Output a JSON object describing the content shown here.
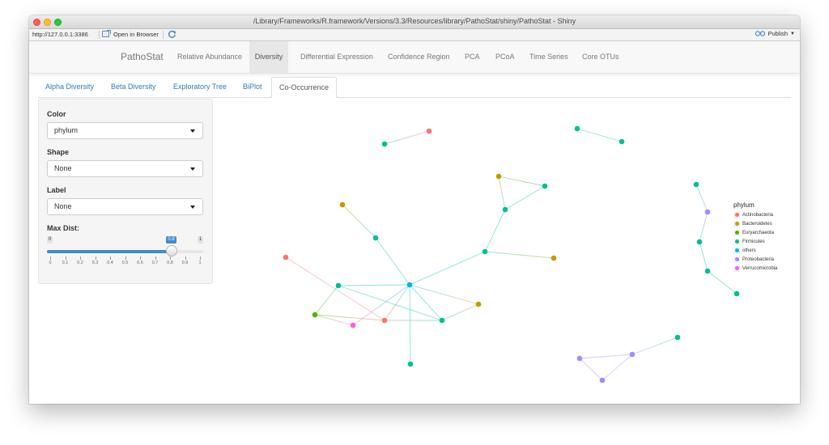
{
  "window": {
    "title": "/Library/Frameworks/R.framework/Versions/3.3/Resources/library/PathoStat/shiny/PathoStat - Shiny"
  },
  "toolbar": {
    "url": "http://127.0.0.1:3386",
    "open_in_browser": "Open in Browser",
    "publish": "Publish"
  },
  "navbar": {
    "brand": "PathoStat",
    "items": [
      {
        "label": "Relative Abundance"
      },
      {
        "label": "Diversity"
      },
      {
        "label": "Differential Expression"
      },
      {
        "label": "Confidence Region"
      },
      {
        "label": "PCA"
      },
      {
        "label": "PCoA"
      },
      {
        "label": "Time Series"
      },
      {
        "label": "Core OTUs"
      }
    ],
    "active": "Diversity"
  },
  "tabs": {
    "items": [
      {
        "label": "Alpha Diversity"
      },
      {
        "label": "Beta Diversity"
      },
      {
        "label": "Exploratory Tree"
      },
      {
        "label": "BiPlot"
      },
      {
        "label": "Co-Occurrence"
      }
    ],
    "active": "Co-Occurrence"
  },
  "sidebar": {
    "color": {
      "label": "Color",
      "value": "phylum"
    },
    "shape": {
      "label": "Shape",
      "value": "None"
    },
    "label": {
      "label": "Label",
      "value": "None"
    },
    "max_dist": {
      "label": "Max Dist:",
      "min": "0",
      "max": "1",
      "value": "0.8",
      "fraction": 0.8,
      "ticks": [
        "0",
        "0.1",
        "0.2",
        "0.3",
        "0.4",
        "0.5",
        "0.6",
        "0.7",
        "0.8",
        "0.9",
        "1"
      ]
    }
  },
  "legend": {
    "title": "phylum",
    "items": [
      {
        "label": "Actinobacteria",
        "color": "#F8766D"
      },
      {
        "label": "Bacteroidetes",
        "color": "#C49A00"
      },
      {
        "label": "Euryarchaeota",
        "color": "#53B400"
      },
      {
        "label": "Firmicutes",
        "color": "#00C094"
      },
      {
        "label": "others",
        "color": "#00B6EB"
      },
      {
        "label": "Proteobacteria",
        "color": "#A58AFF"
      },
      {
        "label": "Verrucomicrobia",
        "color": "#FB61D7"
      }
    ]
  },
  "network": {
    "nodes": [
      {
        "id": "n1",
        "phylum": "Actinobacteria"
      },
      {
        "id": "n2",
        "phylum": "Firmicutes"
      },
      {
        "id": "n3",
        "phylum": "Firmicutes"
      },
      {
        "id": "n4",
        "phylum": "Firmicutes"
      },
      {
        "id": "n5",
        "phylum": "Bacteroidetes"
      },
      {
        "id": "n6",
        "phylum": "Firmicutes"
      },
      {
        "id": "n7",
        "phylum": "Firmicutes"
      },
      {
        "id": "n8",
        "phylum": "Bacteroidetes"
      },
      {
        "id": "n9",
        "phylum": "Firmicutes"
      },
      {
        "id": "n10",
        "phylum": "Bacteroidetes"
      },
      {
        "id": "n11",
        "phylum": "Firmicutes"
      },
      {
        "id": "n12",
        "phylum": "Actinobacteria"
      },
      {
        "id": "n13",
        "phylum": "Firmicutes"
      },
      {
        "id": "n14",
        "phylum": "others"
      },
      {
        "id": "n15",
        "phylum": "Bacteroidetes"
      },
      {
        "id": "n16",
        "phylum": "Euryarchaeota"
      },
      {
        "id": "n17",
        "phylum": "Verrucomicrobia"
      },
      {
        "id": "n18",
        "phylum": "Actinobacteria"
      },
      {
        "id": "n19",
        "phylum": "Firmicutes"
      },
      {
        "id": "n20",
        "phylum": "Firmicutes"
      },
      {
        "id": "n21",
        "phylum": "Firmicutes"
      },
      {
        "id": "n22",
        "phylum": "Proteobacteria"
      },
      {
        "id": "n23",
        "phylum": "Firmicutes"
      },
      {
        "id": "n24",
        "phylum": "Firmicutes"
      },
      {
        "id": "n25",
        "phylum": "Firmicutes"
      },
      {
        "id": "n26",
        "phylum": "Firmicutes"
      },
      {
        "id": "n27",
        "phylum": "Proteobacteria"
      },
      {
        "id": "n28",
        "phylum": "Proteobacteria"
      },
      {
        "id": "n29",
        "phylum": "Proteobacteria"
      }
    ],
    "edges": [
      [
        "n1",
        "n2"
      ],
      [
        "n3",
        "n4"
      ],
      [
        "n5",
        "n6"
      ],
      [
        "n5",
        "n7"
      ],
      [
        "n6",
        "n7"
      ],
      [
        "n7",
        "n9"
      ],
      [
        "n9",
        "n10"
      ],
      [
        "n9",
        "n14"
      ],
      [
        "n8",
        "n11"
      ],
      [
        "n11",
        "n14"
      ],
      [
        "n13",
        "n14"
      ],
      [
        "n14",
        "n15"
      ],
      [
        "n14",
        "n18"
      ],
      [
        "n14",
        "n17"
      ],
      [
        "n14",
        "n19"
      ],
      [
        "n14",
        "n20"
      ],
      [
        "n13",
        "n16"
      ],
      [
        "n13",
        "n19"
      ],
      [
        "n12",
        "n18"
      ],
      [
        "n16",
        "n18"
      ],
      [
        "n16",
        "n17"
      ],
      [
        "n15",
        "n19"
      ],
      [
        "n18",
        "n19"
      ],
      [
        "n21",
        "n22"
      ],
      [
        "n22",
        "n23"
      ],
      [
        "n23",
        "n24"
      ],
      [
        "n24",
        "n25"
      ],
      [
        "n26",
        "n27"
      ],
      [
        "n27",
        "n28"
      ],
      [
        "n27",
        "n29"
      ],
      [
        "n28",
        "n29"
      ]
    ]
  }
}
